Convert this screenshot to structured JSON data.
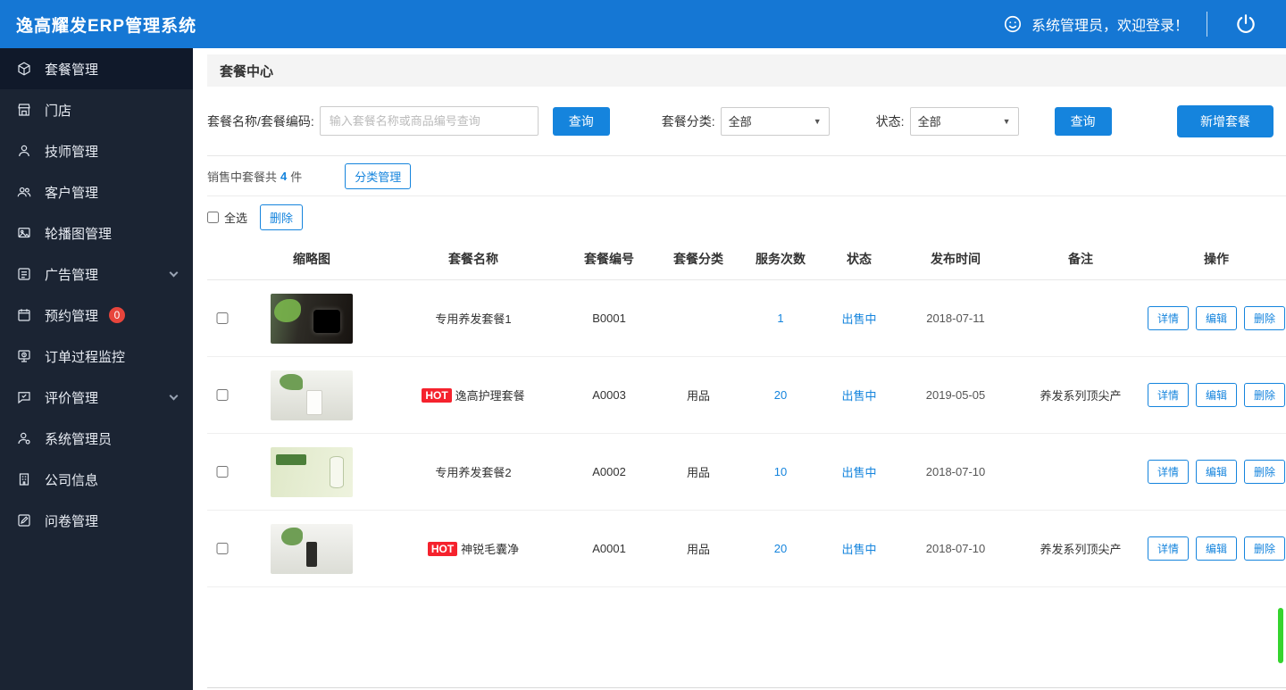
{
  "app": {
    "title": "逸高耀发ERP管理系统"
  },
  "header": {
    "welcome": "系统管理员，欢迎登录！"
  },
  "sidebar": {
    "items": [
      {
        "label": "套餐管理",
        "icon": "package-icon",
        "active": true
      },
      {
        "label": "门店",
        "icon": "store-icon"
      },
      {
        "label": "技师管理",
        "icon": "technician-icon"
      },
      {
        "label": "客户管理",
        "icon": "customers-icon"
      },
      {
        "label": "轮播图管理",
        "icon": "carousel-icon"
      },
      {
        "label": "广告管理",
        "icon": "ad-icon",
        "chevron": true
      },
      {
        "label": "预约管理",
        "icon": "appointment-icon",
        "badge": "0"
      },
      {
        "label": "订单过程监控",
        "icon": "order-monitor-icon"
      },
      {
        "label": "评价管理",
        "icon": "review-icon",
        "chevron": true
      },
      {
        "label": "系统管理员",
        "icon": "admin-icon"
      },
      {
        "label": "公司信息",
        "icon": "company-icon"
      },
      {
        "label": "问卷管理",
        "icon": "survey-icon"
      }
    ]
  },
  "page": {
    "title": "套餐中心"
  },
  "filters": {
    "name_label": "套餐名称/套餐编码:",
    "name_placeholder": "输入套餐名称或商品编号查询",
    "search_button": "查询",
    "category_label": "套餐分类:",
    "category_value": "全部",
    "status_label": "状态:",
    "status_value": "全部",
    "search_button2": "查询",
    "add_button": "新增套餐"
  },
  "summary": {
    "prefix": "销售中套餐共",
    "count": "4",
    "suffix": "件",
    "manage_button": "分类管理"
  },
  "bulk": {
    "select_all_label": "全选",
    "delete_button": "删除"
  },
  "table": {
    "headers": [
      "缩略图",
      "套餐名称",
      "套餐编号",
      "套餐分类",
      "服务次数",
      "状态",
      "发布时间",
      "备注",
      "操作"
    ],
    "hot_label": "HOT",
    "actions": [
      "详情",
      "编辑",
      "删除"
    ],
    "rows": [
      {
        "name": "专用养发套餐1",
        "code": "B0001",
        "category": "",
        "count": "1",
        "status": "出售中",
        "date": "2018-07-11",
        "note": ""
      },
      {
        "name": "逸高护理套餐",
        "hot": true,
        "code": "A0003",
        "category": "用品",
        "count": "20",
        "status": "出售中",
        "date": "2019-05-05",
        "note": "养发系列顶尖产"
      },
      {
        "name": "专用养发套餐2",
        "code": "A0002",
        "category": "用品",
        "count": "10",
        "status": "出售中",
        "date": "2018-07-10",
        "note": ""
      },
      {
        "name": "神锐毛囊净",
        "hot": true,
        "code": "A0001",
        "category": "用品",
        "count": "20",
        "status": "出售中",
        "date": "2018-07-10",
        "note": "养发系列顶尖产"
      }
    ]
  },
  "colors": {
    "accent": "#1584dd",
    "header-bg": "#1577d4",
    "sidebar-bg": "#1b2433",
    "hot": "#f5222d",
    "badge": "#e8453c",
    "scrollbar": "#35d42e"
  }
}
